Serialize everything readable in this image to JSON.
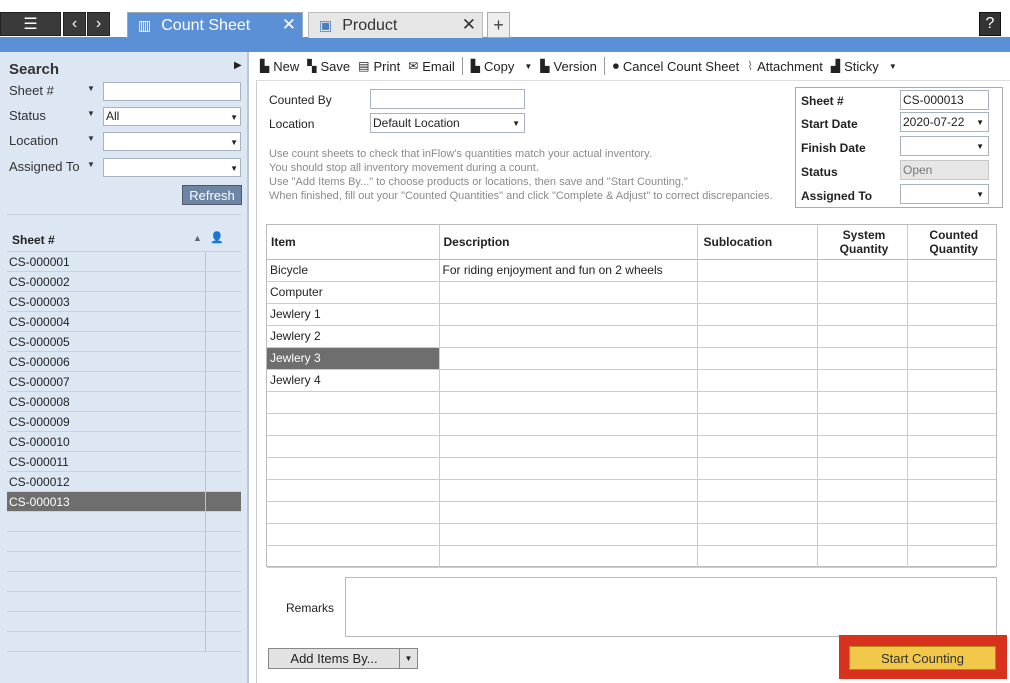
{
  "topbar": {
    "menu_icon": "hamburger-icon",
    "back_icon": "chevron-left-icon",
    "forward_icon": "chevron-right-icon",
    "help_label": "?",
    "tabs": [
      {
        "label": "Count Sheet",
        "active": true
      },
      {
        "label": "Product",
        "active": false
      }
    ],
    "close_glyph": "✕",
    "add_tab_glyph": "+"
  },
  "search": {
    "title": "Search",
    "fields": [
      {
        "label": "Sheet #",
        "value": ""
      },
      {
        "label": "Status",
        "value": "All"
      },
      {
        "label": "Location",
        "value": ""
      },
      {
        "label": "Assigned To",
        "value": ""
      }
    ],
    "refresh_label": "Refresh"
  },
  "sheet_list": {
    "header": "Sheet #",
    "rows": [
      "CS-000001",
      "CS-000002",
      "CS-000003",
      "CS-000004",
      "CS-000005",
      "CS-000006",
      "CS-000007",
      "CS-000008",
      "CS-000009",
      "CS-000010",
      "CS-000011",
      "CS-000012",
      "CS-000013"
    ],
    "selected": "CS-000013"
  },
  "toolbar": {
    "new": "New",
    "save": "Save",
    "print": "Print",
    "email": "Email",
    "copy": "Copy",
    "version": "Version",
    "cancel": "Cancel Count Sheet",
    "attachment": "Attachment",
    "sticky": "Sticky"
  },
  "form": {
    "counted_by_label": "Counted By",
    "counted_by_value": "",
    "location_label": "Location",
    "location_value": "Default Location",
    "hints": [
      "Use count sheets to check that inFlow's quantities match your actual inventory.",
      "You should stop all inventory movement during a count.",
      "Use \"Add Items By...\" to choose products or locations, then save and \"Start Counting.\"",
      "When finished, fill out your \"Counted Quantities\" and click \"Complete & Adjust\" to correct discrepancies."
    ]
  },
  "details": {
    "sheet_label": "Sheet #",
    "sheet_value": "CS-000013",
    "start_label": "Start Date",
    "start_value": "2020-07-22",
    "finish_label": "Finish Date",
    "finish_value": "",
    "status_label": "Status",
    "status_value": "Open",
    "assigned_label": "Assigned To",
    "assigned_value": ""
  },
  "grid": {
    "headers": {
      "item": "Item",
      "description": "Description",
      "sublocation": "Sublocation",
      "system_qty": "System Quantity",
      "counted_qty": "Counted Quantity"
    },
    "rows": [
      {
        "item": "Bicycle",
        "description": "For riding enjoyment and fun on 2 wheels"
      },
      {
        "item": "Computer",
        "description": ""
      },
      {
        "item": "Jewlery 1",
        "description": ""
      },
      {
        "item": "Jewlery 2",
        "description": ""
      },
      {
        "item": "Jewlery 3",
        "description": ""
      },
      {
        "item": "Jewlery 4",
        "description": ""
      }
    ],
    "selected_item": "Jewlery 3"
  },
  "remarks_label": "Remarks",
  "add_items_label": "Add Items By...",
  "start_counting_label": "Start Counting",
  "colors": {
    "accent": "#5b8fd6",
    "highlight": "#d8321f",
    "start_button": "#f2c84b"
  }
}
